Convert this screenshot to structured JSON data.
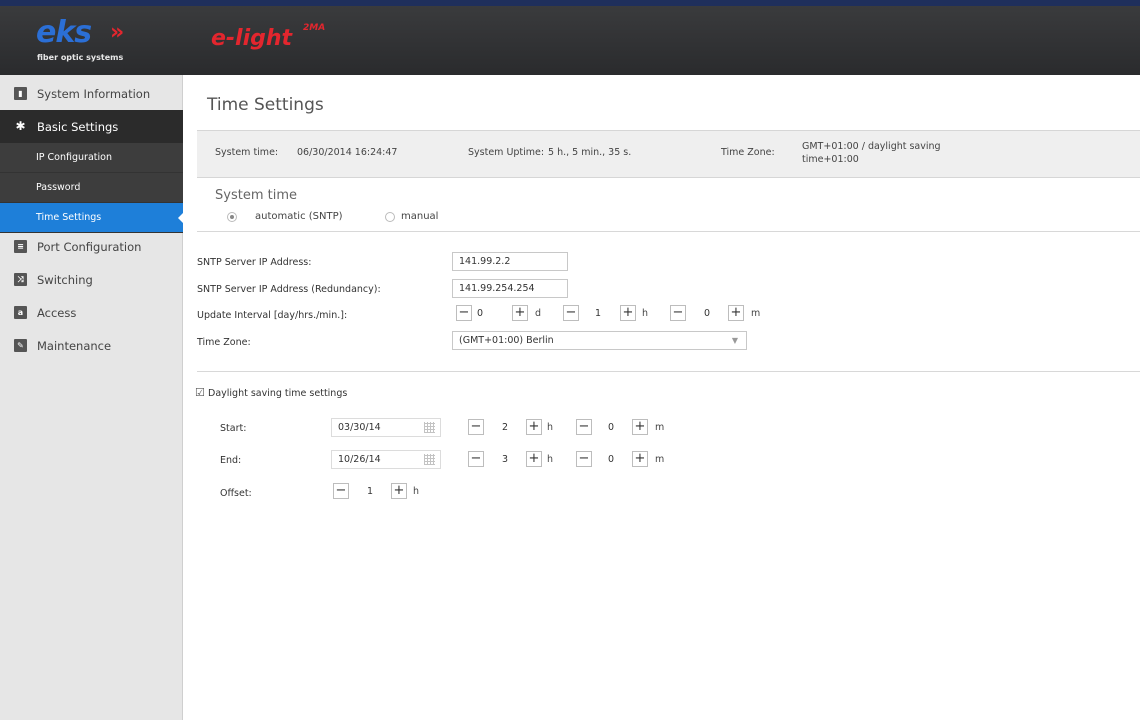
{
  "header": {
    "brand_name": "eks",
    "brand_arrows": "»",
    "brand_tagline": "fiber optic systems",
    "product_name": "e-light",
    "product_sup": "2MA"
  },
  "sidebar": {
    "items": [
      {
        "label": "System Information",
        "icon": "chart-icon"
      },
      {
        "label": "Basic Settings",
        "icon": "gear-icon"
      },
      {
        "label": "Port Configuration",
        "icon": "port-icon"
      },
      {
        "label": "Switching",
        "icon": "switching-icon"
      },
      {
        "label": "Access",
        "icon": "lock-icon"
      },
      {
        "label": "Maintenance",
        "icon": "wrench-icon"
      }
    ],
    "subitems": [
      {
        "label": "IP Configuration"
      },
      {
        "label": "Password"
      },
      {
        "label": "Time Settings"
      }
    ]
  },
  "page": {
    "title": "Time Settings"
  },
  "info": {
    "system_time_label": "System time:",
    "system_time_value": "06/30/2014 16:24:47",
    "uptime_label": "System Uptime:",
    "uptime_value": "5 h., 5 min., 35 s.",
    "timezone_label": "Time Zone:",
    "timezone_value_1": "GMT+01:00 / daylight saving",
    "timezone_value_2": "time+01:00"
  },
  "system_time": {
    "section_title": "System time",
    "option_auto": "automatic (SNTP)",
    "option_manual": "manual",
    "selected": "automatic (SNTP)"
  },
  "form": {
    "sntp_label": "SNTP Server IP Address:",
    "sntp_value": "141.99.2.2",
    "sntp_redundancy_label": "SNTP Server IP Address (Redundancy):",
    "sntp_redundancy_value": "141.99.254.254",
    "interval_label": "Update Interval [day/hrs./min.]:",
    "interval_days": "0",
    "interval_days_unit": "d",
    "interval_hours": "1",
    "interval_hours_unit": "h",
    "interval_minutes": "0",
    "interval_minutes_unit": "m",
    "timezone_label": "Time Zone:",
    "timezone_value": "(GMT+01:00) Berlin"
  },
  "dst": {
    "checkbox_label": "Daylight saving time settings",
    "checked": true,
    "start_label": "Start:",
    "start_date": "03/30/14",
    "start_hour": "2",
    "start_minute": "0",
    "end_label": "End:",
    "end_date": "10/26/14",
    "end_hour": "3",
    "end_minute": "0",
    "offset_label": "Offset:",
    "offset_value": "1",
    "hour_unit": "h",
    "minute_unit": "m",
    "minus": "−",
    "plus": "+"
  }
}
